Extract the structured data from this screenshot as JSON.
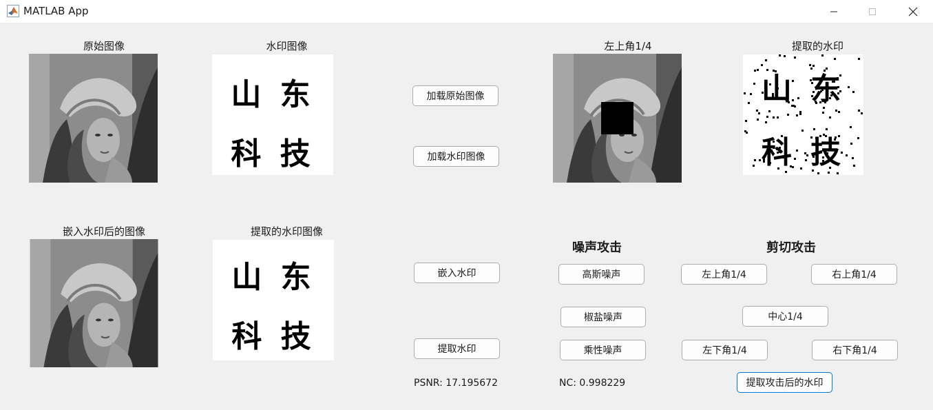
{
  "window": {
    "title": "MATLAB App"
  },
  "labels": {
    "original": "原始图像",
    "watermark": "水印图像",
    "embedded": "嵌入水印后的图像",
    "extracted": "提取的水印图像",
    "attack_result": "左上角1/4",
    "attack_extracted": "提取的水印"
  },
  "watermark_text": {
    "line1": "山 东",
    "line2": "科 技"
  },
  "buttons": {
    "load_original": "加载原始图像",
    "load_watermark": "加载水印图像",
    "embed": "嵌入水印",
    "extract": "提取水印",
    "gaussian": "高斯噪声",
    "salt_pepper": "椒盐噪声",
    "speckle": "乘性噪声",
    "crop_top_left": "左上角1/4",
    "crop_top_right": "右上角1/4",
    "crop_center": "中心1/4",
    "crop_bottom_left": "左下角1/4",
    "crop_bottom_right": "右下角1/4",
    "extract_after_attack": "提取攻击后的水印"
  },
  "sections": {
    "noise": "噪声攻击",
    "crop": "剪切攻击"
  },
  "status": {
    "psnr": "PSNR: 17.195672",
    "nc": "NC: 0.998229"
  },
  "colors": {
    "focus_border": "#0078d4",
    "background": "#f0f0f0"
  }
}
